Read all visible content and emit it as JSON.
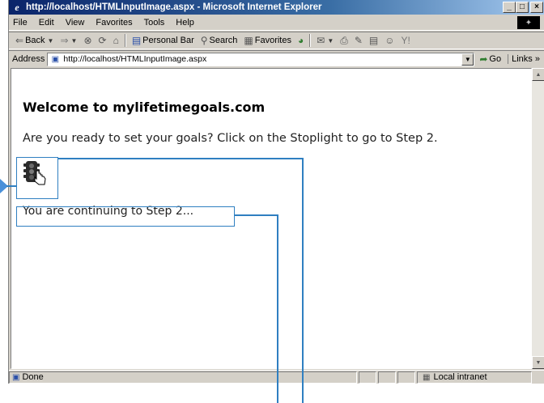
{
  "window": {
    "title": "http://localhost/HTMLInputImage.aspx - Microsoft Internet Explorer",
    "app_icon": "ie-icon",
    "controls": {
      "minimize": "_",
      "maximize": "□",
      "close": "×"
    }
  },
  "menu": {
    "items": [
      "File",
      "Edit",
      "View",
      "Favorites",
      "Tools",
      "Help"
    ]
  },
  "toolbar": {
    "back_label": "Back",
    "personal_bar_label": "Personal Bar",
    "search_label": "Search",
    "favorites_label": "Favorites"
  },
  "address_bar": {
    "label": "Address",
    "url": "http://localhost/HTMLInputImage.aspx",
    "go_label": "Go",
    "links_label": "Links »"
  },
  "page": {
    "heading": "Welcome to mylifetimegoals.com",
    "prompt": "Are you ready to set your goals? Click on the Stoplight to go to Step 2.",
    "stoplight_icon": "stoplight-icon",
    "continue_message": "You are continuing to Step 2..."
  },
  "status_bar": {
    "status_text": "Done",
    "zone_label": "Local intranet"
  },
  "colors": {
    "title_bar": "#0a246a",
    "callout": "#2f7fc1",
    "chrome": "#d4d0c8"
  }
}
